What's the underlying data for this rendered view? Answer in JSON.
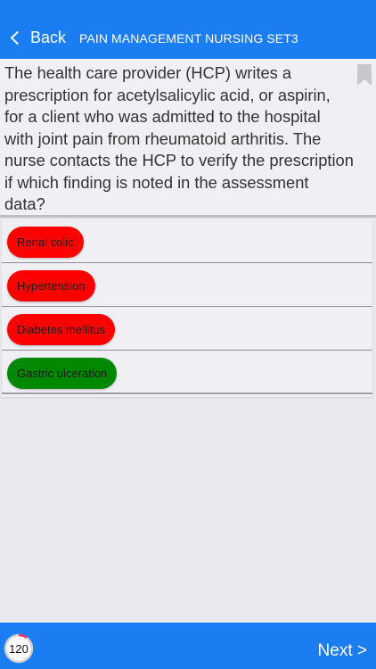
{
  "navbar": {
    "back_label": "Back",
    "title": "PAIN MANAGEMENT NURSING SET3",
    "color": "#1a7df1"
  },
  "question": {
    "text": "The health care provider (HCP) writes a prescription for acetylsalicylic acid, or aspirin, for a client who was admitted to the hospital with joint pain from rheumatoid arthritis. The nurse contacts the HCP to verify the prescription if which finding is noted in the assessment data?",
    "bookmark_icon": "bookmark-icon"
  },
  "answers": [
    {
      "label": "Renal colic",
      "state": "wrong",
      "color": "#ff0000"
    },
    {
      "label": "Hypertension",
      "state": "wrong",
      "color": "#ff0000"
    },
    {
      "label": "Diabetes mellitus",
      "state": "wrong",
      "color": "#ff0000"
    },
    {
      "label": "Gastric ulceration",
      "state": "correct",
      "color": "#008800"
    }
  ],
  "footer": {
    "counter": "120",
    "counter_progress": 0.1,
    "progress_color": "#ff2d55",
    "next_label": "Next >"
  }
}
